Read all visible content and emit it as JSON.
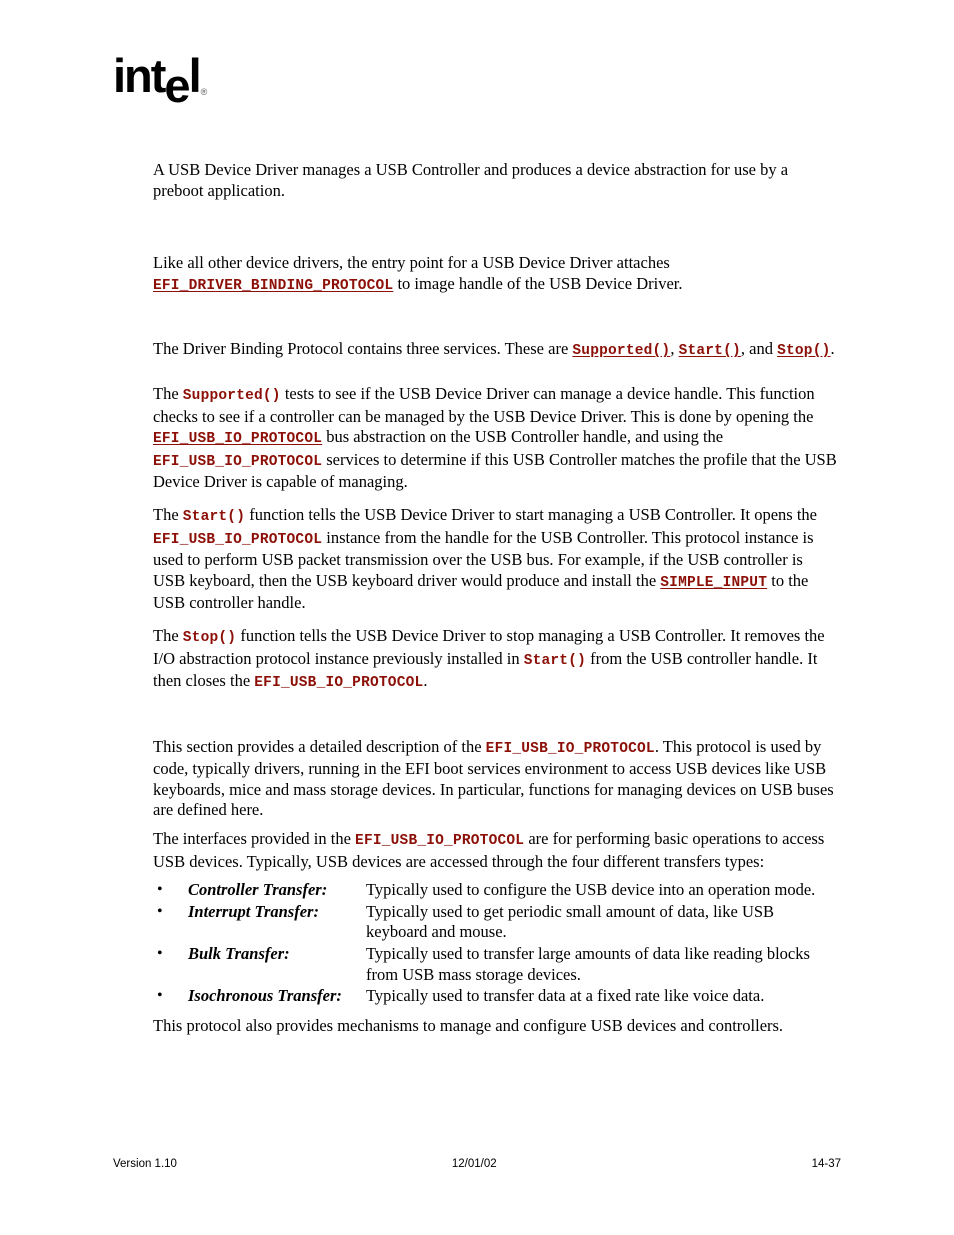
{
  "logo": {
    "text_int": "int",
    "text_e": "e",
    "text_l": "l",
    "registered_mark": "®"
  },
  "colors": {
    "code_red": "#8C1008",
    "body_text": "#000000",
    "page_background": "#ffffff"
  },
  "body": {
    "p1": {
      "text": "A USB Device Driver manages a USB Controller and produces a device abstraction for use by a preboot application."
    },
    "p2": {
      "part1": "Like all other device drivers, the entry point for a USB Device Driver attaches ",
      "code1": "EFI_DRIVER_BINDING_PROTOCOL",
      "part2": " to image handle of the USB Device Driver."
    },
    "p3": {
      "part1": "The Driver Binding Protocol contains three services.  These are ",
      "code1": "Supported()",
      "part2": ", ",
      "code2": "Start()",
      "part3": ", and ",
      "code3": "Stop()",
      "part4": "."
    },
    "p4": {
      "part1": "The ",
      "code1": "Supported()",
      "part2": " tests to see if the USB Device Driver can manage a device handle.  This function checks to see if a controller can be managed by the USB Device Driver.  This is done by opening the ",
      "code2": "EFI_USB_IO_PROTOCOL",
      "part3": " bus abstraction on the USB Controller handle, and using the ",
      "code3": "EFI_USB_IO_PROTOCOL",
      "part4": " services to determine if this USB Controller matches the profile that the USB Device Driver is capable of managing."
    },
    "p5": {
      "part1": "The ",
      "code1": "Start()",
      "part2": " function tells the USB Device Driver to start managing a USB Controller.  It opens the ",
      "code2": "EFI_USB_IO_PROTOCOL",
      "part3": " instance from the handle for the USB Controller.  This protocol instance is used to perform USB packet transmission over the USB bus.  For example, if the USB controller is USB keyboard, then the USB keyboard driver would produce and install the ",
      "code3": "SIMPLE_INPUT",
      "part4": " to the USB controller handle."
    },
    "p6": {
      "part1": "The ",
      "code1": "Stop()",
      "part2": " function tells the USB Device Driver to stop managing a USB Controller.  It removes the I/O abstraction protocol instance previously installed in ",
      "code2": "Start()",
      "part3": " from the USB controller handle.  It then closes the ",
      "code3": "EFI_USB_IO_PROTOCOL",
      "part4": "."
    },
    "p7": {
      "part1": "This section provides a detailed description of the ",
      "code1": "EFI_USB_IO_PROTOCOL",
      "part2": ".  This protocol is used by code, typically drivers, running in the EFI boot services environment to access USB devices like USB keyboards, mice and mass storage devices.  In particular, functions for managing devices on USB buses are defined here."
    },
    "p8": {
      "part1": "The interfaces provided in the ",
      "code1": "EFI_USB_IO_PROTOCOL",
      "part2": " are for performing basic operations to access USB devices.  Typically, USB devices are accessed through the four different transfers types:"
    },
    "p9": {
      "text": "This protocol also provides mechanisms to manage and configure USB devices and controllers."
    }
  },
  "transfer_list": {
    "bullet_glyph": "•",
    "items": [
      {
        "label": "Controller Transfer:",
        "description": "Typically used to configure the USB device into an operation mode."
      },
      {
        "label": "Interrupt Transfer:",
        "description": "Typically used to get periodic small amount of data, like USB keyboard and mouse."
      },
      {
        "label": "Bulk Transfer:",
        "description": "Typically used to transfer large amounts of data like reading blocks from USB mass storage devices."
      },
      {
        "label": "Isochronous Transfer:",
        "description": "Typically used to transfer data at a fixed rate like voice data."
      }
    ]
  },
  "footer": {
    "version": "Version 1.10",
    "date": "12/01/02",
    "page_number": "14-37"
  }
}
